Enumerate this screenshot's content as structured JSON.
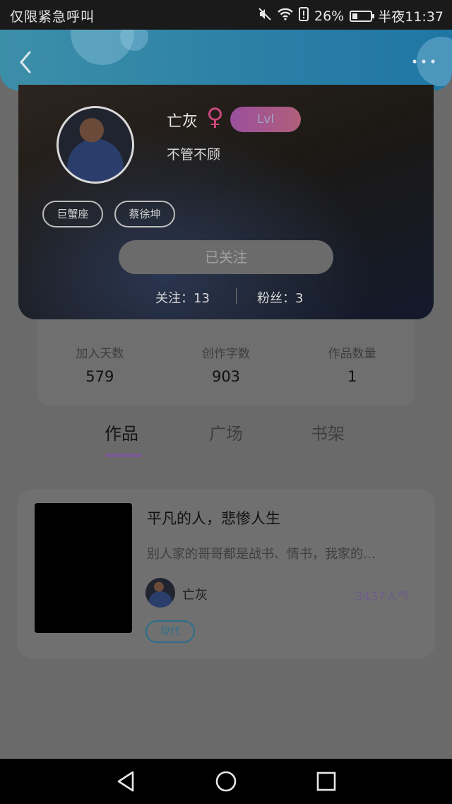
{
  "status_bar": {
    "left_text": "仅限紧急呼叫",
    "battery_percent": "26%",
    "time": "半夜11:37",
    "icons": [
      "mute-icon",
      "wifi-icon",
      "alert-icon",
      "battery-icon"
    ]
  },
  "header": {
    "icons": [
      "back-arrow-icon",
      "more-dots-icon"
    ]
  },
  "profile": {
    "username": "亡灰",
    "gender_symbol": "♀",
    "level": "Lvl",
    "signature": "不管不顾",
    "tags": [
      "巨蟹座",
      "蔡徐坤"
    ],
    "follow_button": "已关注",
    "following": "关注：13",
    "fans": "粉丝：3"
  },
  "stats": [
    {
      "label": "加入天数",
      "value": "579"
    },
    {
      "label": "创作字数",
      "value": "903"
    },
    {
      "label": "作品数量",
      "value": "1"
    }
  ],
  "tabs": [
    {
      "label": "作品",
      "active": true
    },
    {
      "label": "广场",
      "active": false
    },
    {
      "label": "书架",
      "active": false
    }
  ],
  "work": {
    "title": "平凡的人，悲惨人生",
    "description": "别人家的哥哥都是战书、情书，我家的…",
    "author": "亡灰",
    "popularity": "3437人气",
    "genre": "现代"
  },
  "colors": {
    "header_gradient": "#2a7fa6",
    "accent_purple": "#7a5a92",
    "genre_blue": "#2c6e8c",
    "gender_pink": "#c9477a"
  }
}
